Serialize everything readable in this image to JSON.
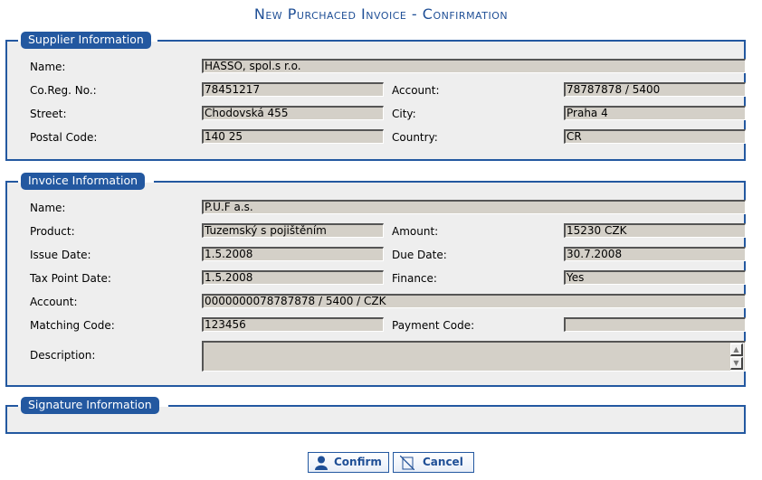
{
  "page": {
    "title": "New Purchaced Invoice - Confirmation"
  },
  "supplier": {
    "legend": "Supplier Information",
    "name_label": "Name:",
    "name_value": "HASSO, spol.s r.o.",
    "coreg_label": "Co.Reg. No.:",
    "coreg_value": "78451217",
    "account_label": "Account:",
    "account_value": "78787878 / 5400",
    "street_label": "Street:",
    "street_value": "Chodovská 455",
    "city_label": "City:",
    "city_value": "Praha 4",
    "postal_label": "Postal Code:",
    "postal_value": "140 25",
    "country_label": "Country:",
    "country_value": "ČR"
  },
  "invoice": {
    "legend": "Invoice Information",
    "name_label": "Name:",
    "name_value": "P.U.F a.s.",
    "product_label": "Product:",
    "product_value": "Tuzemský s pojištěním",
    "amount_label": "Amount:",
    "amount_value": "15230 CZK",
    "issue_label": "Issue Date:",
    "issue_value": "1.5.2008",
    "due_label": "Due Date:",
    "due_value": "30.7.2008",
    "taxpoint_label": "Tax Point Date:",
    "taxpoint_value": "1.5.2008",
    "finance_label": "Finance:",
    "finance_value": "Yes",
    "account_label": "Account:",
    "account_value": "0000000078787878 / 5400 / CZK",
    "matching_label": "Matching Code:",
    "matching_value": "123456",
    "payment_label": "Payment Code:",
    "payment_value": "",
    "description_label": "Description:",
    "description_value": ""
  },
  "signature": {
    "legend": "Signature Information"
  },
  "actions": {
    "confirm_label": "Confirm",
    "cancel_label": "Cancel"
  },
  "colors": {
    "accent": "#2358a0",
    "title": "#1f4f96",
    "field_bg": "#d4d0c8",
    "panel_bg": "#eeeeee"
  }
}
